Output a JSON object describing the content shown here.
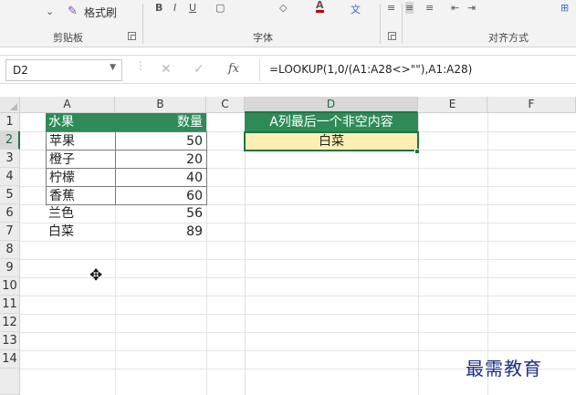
{
  "ribbon": {
    "format_painter_label": "格式刷",
    "groups": {
      "clipboard": "剪贴板",
      "font": "字体",
      "alignment": "对齐方式"
    }
  },
  "formula_bar": {
    "name_box": "D2",
    "formula": "=LOOKUP(1,0/(A1:A28<>\"\"),A1:A28)",
    "fx_label": "fx"
  },
  "columns": [
    "A",
    "B",
    "C",
    "D",
    "E",
    "F"
  ],
  "rows": [
    "1",
    "2",
    "3",
    "4",
    "5",
    "6",
    "7",
    "8",
    "9",
    "10",
    "11",
    "12",
    "13",
    "14"
  ],
  "table": {
    "header": {
      "a": "水果",
      "b": "数量"
    },
    "rows": [
      {
        "a": "苹果",
        "b": "50"
      },
      {
        "a": "橙子",
        "b": "20"
      },
      {
        "a": "柠檬",
        "b": "40"
      },
      {
        "a": "香蕉",
        "b": "60"
      },
      {
        "a": "兰色",
        "b": "56"
      },
      {
        "a": "白菜",
        "b": "89"
      }
    ]
  },
  "result": {
    "header": "A列最后一个非空内容",
    "value": "白菜"
  },
  "watermark": "最需教育",
  "colors": {
    "header_green": "#2e8b57",
    "excel_green": "#217346",
    "result_fill": "#fdeeb4"
  }
}
